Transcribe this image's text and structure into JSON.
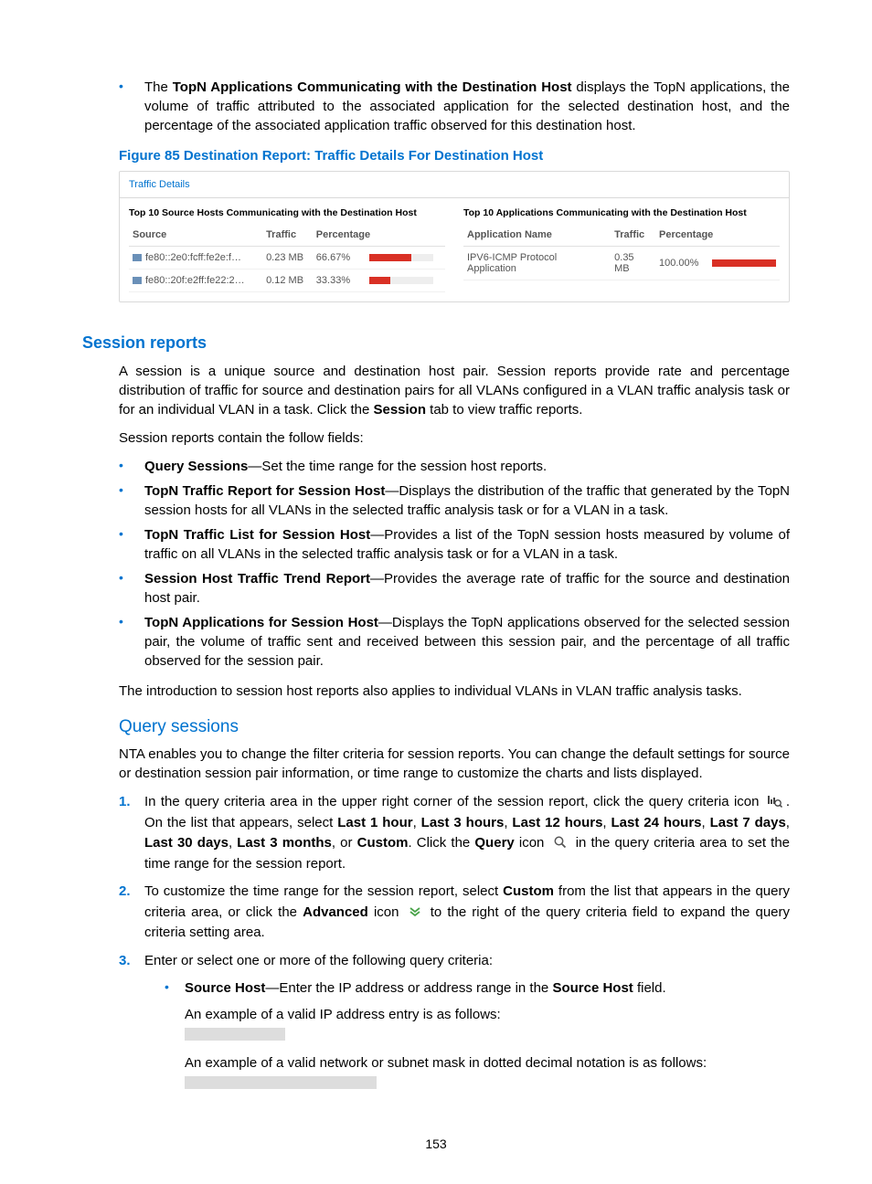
{
  "top_bullet": {
    "lead": "The ",
    "bold": "TopN Applications Communicating with the Destination Host",
    "rest": " displays the TopN applications, the volume of traffic attributed to the associated application for the selected destination host, and the percentage of the associated application traffic observed for this destination host."
  },
  "figure_caption": "Figure 85 Destination Report: Traffic Details For Destination Host",
  "panel": {
    "title": "Traffic Details",
    "left_title": "Top 10 Source Hosts Communicating with the Destination Host",
    "right_title": "Top 10 Applications Communicating with the Destination Host",
    "left_headers": {
      "c1": "Source",
      "c2": "Traffic",
      "c3": "Percentage"
    },
    "right_headers": {
      "c1": "Application Name",
      "c2": "Traffic",
      "c3": "Percentage"
    },
    "left_rows": [
      {
        "source": "fe80::2e0:fcff:fe2e:f…",
        "traffic": "0.23 MB",
        "pct_text": "66.67%",
        "pct": 66.67
      },
      {
        "source": "fe80::20f:e2ff:fe22:2…",
        "traffic": "0.12 MB",
        "pct_text": "33.33%",
        "pct": 33.33
      }
    ],
    "right_rows": [
      {
        "name": "IPV6-ICMP Protocol Application",
        "traffic": "0.35 MB",
        "pct_text": "100.00%",
        "pct": 100
      }
    ]
  },
  "session_heading": "Session reports",
  "session_p1": "A session is a unique source and destination host pair. Session reports provide rate and percentage distribution of traffic for source and destination pairs for all VLANs configured in a VLAN traffic analysis task or for an individual VLAN in a task. Click the ",
  "session_p1_bold": "Session",
  "session_p1_end": " tab to view traffic reports.",
  "session_p2": "Session reports contain the follow fields:",
  "fields": [
    {
      "name": "Query Sessions",
      "desc": "—Set the time range for the session host reports."
    },
    {
      "name": "TopN Traffic Report for Session Host",
      "desc": "—Displays the distribution of the traffic that generated by the TopN session hosts for all VLANs in the selected traffic analysis task or for a VLAN in a task."
    },
    {
      "name": "TopN Traffic List for Session Host",
      "desc": "—Provides a list of the TopN session hosts measured by volume of traffic on all VLANs in the selected traffic analysis task or for a VLAN in a task."
    },
    {
      "name": "Session Host Traffic Trend Report",
      "desc": "—Provides the average rate of traffic for the source and destination host pair."
    },
    {
      "name": "TopN Applications for Session Host",
      "desc": "—Displays the TopN applications observed for the selected session pair, the volume of traffic sent and received between this session pair, and the percentage of all traffic observed for the session pair."
    }
  ],
  "session_intro_end": "The introduction to session host reports also applies to individual VLANs in VLAN traffic analysis tasks.",
  "query_heading": "Query sessions",
  "query_intro": "NTA enables you to change the filter criteria for session reports. You can change the default settings for source or destination session pair information, or time range to customize the charts and lists displayed.",
  "step1": {
    "pre": "In the query criteria area in the upper right corner of the session report, click the query criteria icon ",
    "mid": ". On the list that appears, select ",
    "opts": [
      "Last 1 hour",
      "Last 3 hours",
      "Last 12 hours",
      "Last 24 hours",
      "Last 7 days",
      "Last 30 days",
      "Last 3 months"
    ],
    "or": ", or ",
    "custom": "Custom",
    "after_custom": ". Click the ",
    "query_b": "Query",
    "tail": " in the query criteria area to set the time range for the session report.",
    "icon_word": " icon"
  },
  "step2": {
    "pre": "To customize the time range for the session report, select ",
    "custom": "Custom",
    "mid": " from the list that appears in the query criteria area, or click the ",
    "adv": "Advanced",
    "icon_word": " icon",
    "tail": " to the right of the query criteria field to expand the query criteria setting area."
  },
  "step3": {
    "intro": "Enter or select one or more of the following query criteria:",
    "sub": {
      "name": "Source Host",
      "desc_pre": "—Enter the IP address or address range in the ",
      "desc_bold": "Source Host",
      "desc_end": " field.",
      "ex1": "An example of a valid IP address entry is as follows:",
      "ex2": "An example of a valid network or subnet mask in dotted decimal notation is as follows:"
    }
  },
  "pagenum": "153"
}
